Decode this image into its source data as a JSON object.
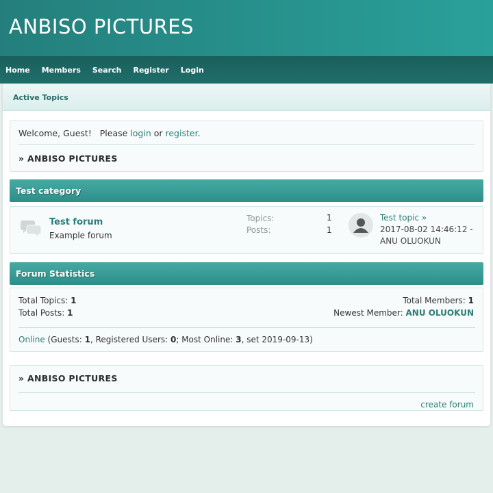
{
  "site": {
    "title": "ANBISO PICTURES"
  },
  "nav": {
    "items": [
      {
        "label": "Home"
      },
      {
        "label": "Members"
      },
      {
        "label": "Search"
      },
      {
        "label": "Register"
      },
      {
        "label": "Login"
      }
    ]
  },
  "subnav": {
    "active_topics": "Active Topics"
  },
  "welcome": {
    "prefix": "Welcome, Guest!   Please ",
    "login": "login",
    "or": " or ",
    "register": "register",
    "suffix": ".",
    "breadcrumb_arrow": "»",
    "breadcrumb": "ANBISO PICTURES"
  },
  "category": {
    "title": "Test category",
    "forum": {
      "name": "Test forum",
      "description": "Example forum",
      "topics_label": "Topics:",
      "topics_count": "1",
      "posts_label": "Posts:",
      "posts_count": "1",
      "last_post": {
        "topic": "Test topic",
        "arrow": "»",
        "date": "2017-08-02 14:46:12 -",
        "user": "ANU OLUOKUN"
      }
    }
  },
  "stats": {
    "title": "Forum Statistics",
    "total_topics_label": "Total Topics: ",
    "total_topics": "1",
    "total_posts_label": "Total Posts: ",
    "total_posts": "1",
    "total_members_label": "Total Members: ",
    "total_members": "1",
    "newest_member_label": "Newest Member: ",
    "newest_member": "ANU OLUOKUN",
    "online_link": "Online",
    "guests_label": " (Guests: ",
    "guests": "1",
    "registered_label": ", Registered Users: ",
    "registered": "0",
    "most_online_label": "; Most Online: ",
    "most_online": "3",
    "most_online_date": ", set 2019-09-13)"
  },
  "footer": {
    "breadcrumb_arrow": "»",
    "breadcrumb": "ANBISO PICTURES",
    "create_forum": "create forum"
  },
  "colors": {
    "header": "#2aa09a",
    "navbar": "#1a5f5c",
    "link": "#2a7d78",
    "category_bar": "#3a9c95"
  },
  "icons": {
    "forum": "speech-bubbles-icon",
    "avatar": "default-user-icon"
  }
}
